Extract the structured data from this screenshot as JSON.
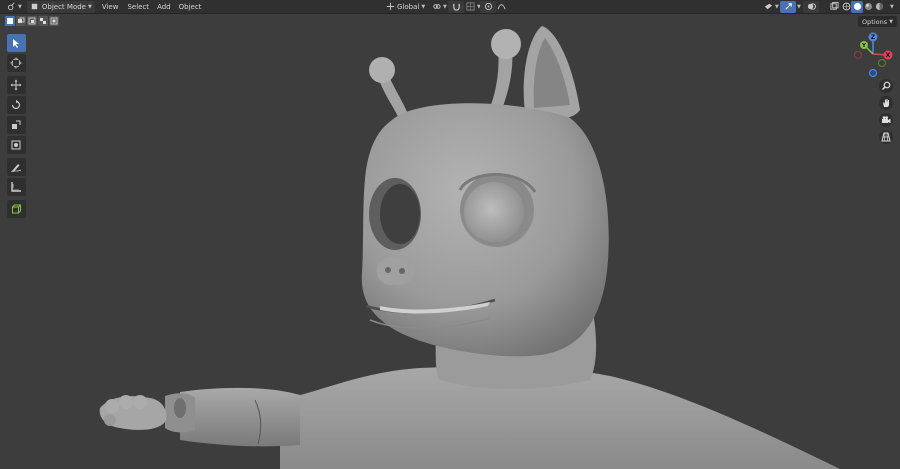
{
  "header": {
    "mode_label": "Object Mode",
    "menu": [
      "View",
      "Select",
      "Add",
      "Object"
    ],
    "transform_orientation": "Global",
    "editor_icon": "editor-type-icon",
    "snap_icon": "snap-magnet-icon",
    "proportional_icon": "proportional-edit-icon"
  },
  "viewport": {
    "options_label": "Options",
    "shading_modes": [
      "wireframe",
      "solid",
      "material-preview",
      "rendered"
    ],
    "active_shading": "solid"
  },
  "toolbar": {
    "tools": [
      "select-box",
      "cursor",
      "move",
      "rotate",
      "scale",
      "transform",
      "annotate",
      "measure",
      "add-cube"
    ],
    "active_tool": "select-box"
  },
  "navigation": {
    "gizmo_axes": [
      "X",
      "Y",
      "Z"
    ],
    "axis_colors": {
      "x": "#e3425a",
      "y": "#8ac33d",
      "z": "#4c88e8"
    },
    "buttons": [
      "zoom",
      "pan",
      "camera",
      "grid-view"
    ]
  },
  "colors": {
    "viewport_bg": "#3d3d3d",
    "header_bg": "#303030",
    "accent": "#4772b3",
    "model": "#a3a3a3"
  }
}
